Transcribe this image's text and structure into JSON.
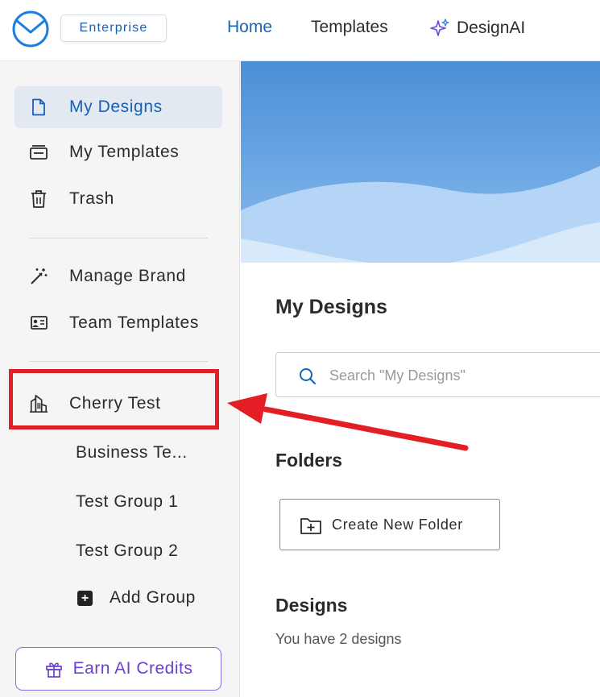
{
  "header": {
    "badge": "Enterprise",
    "nav": {
      "home": "Home",
      "templates": "Templates",
      "designai": "DesignAI"
    }
  },
  "sidebar": {
    "items": [
      {
        "label": "My Designs",
        "icon": "document-icon",
        "active": true
      },
      {
        "label": "My Templates",
        "icon": "templates-icon"
      },
      {
        "label": "Trash",
        "icon": "trash-icon"
      },
      {
        "label": "Manage Brand",
        "icon": "magic-wand-icon"
      },
      {
        "label": "Team Templates",
        "icon": "team-templates-icon"
      },
      {
        "label": "Cherry Test",
        "icon": "building-icon"
      }
    ],
    "groups": [
      "Business Te...",
      "Test Group 1",
      "Test Group 2"
    ],
    "add_group": "Add Group",
    "earn_credits": "Earn AI Credits"
  },
  "main": {
    "title": "My Designs",
    "search_placeholder": "Search \"My Designs\"",
    "folders_heading": "Folders",
    "create_folder": "Create New Folder",
    "designs_heading": "Designs",
    "designs_count": "You have 2 designs"
  },
  "colors": {
    "accent": "#1a65b8",
    "active_bg": "#e3e9f1",
    "hero_blue": "#4a8fd6",
    "annotation_red": "#e31e24",
    "credits_purple": "#6b3fd4"
  }
}
